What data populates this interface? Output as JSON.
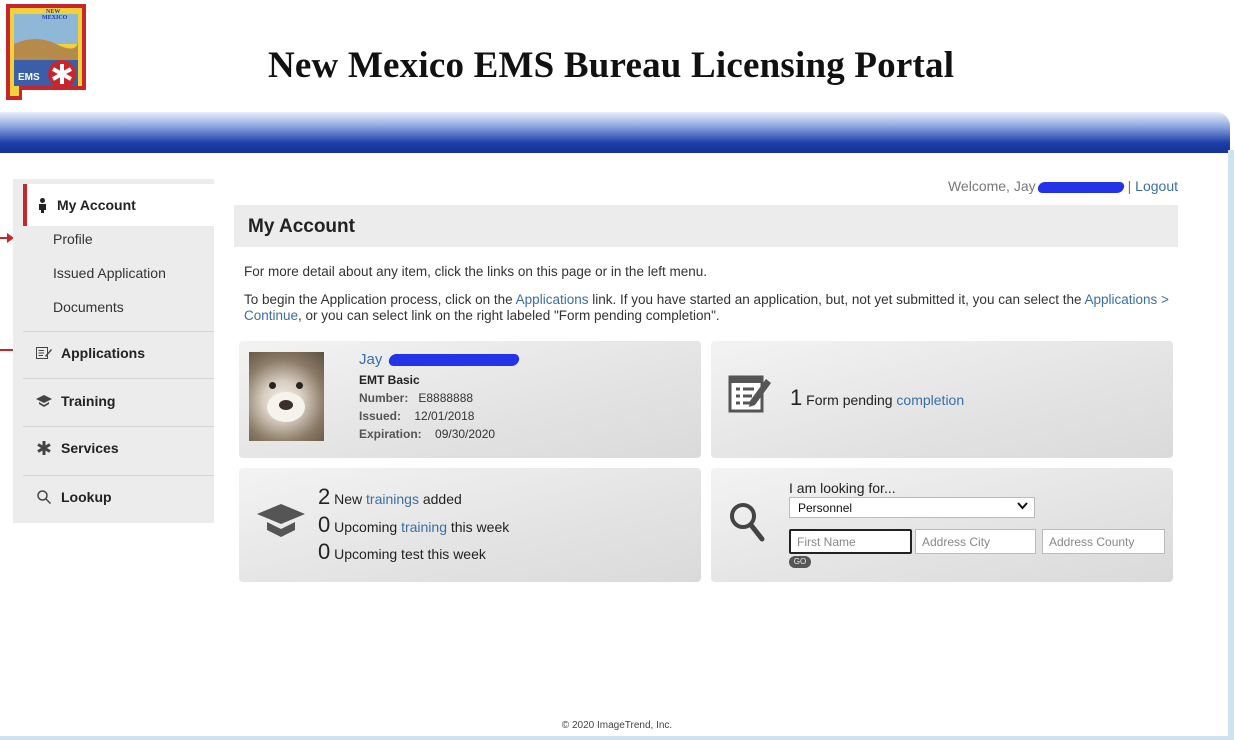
{
  "header": {
    "logo_alt": "NEW MEXICO EMS",
    "logo_top_text": "NEW MEXICO",
    "logo_bottom_text": "EMS",
    "title": "New Mexico EMS Bureau Licensing Portal"
  },
  "sidebar": {
    "my_account": {
      "label": "My Account",
      "icon": "person-icon"
    },
    "sub_items": [
      "Profile",
      "Issued Application",
      "Documents"
    ],
    "items": [
      {
        "label": "Applications",
        "icon": "form-edit-icon"
      },
      {
        "label": "Training",
        "icon": "graduation-cap-icon"
      },
      {
        "label": "Services",
        "icon": "star-of-life-icon"
      },
      {
        "label": "Lookup",
        "icon": "magnifier-icon"
      }
    ]
  },
  "welcome": {
    "text": "Welcome, Jay",
    "separator": "|",
    "logout": "Logout"
  },
  "main": {
    "heading": "My Account",
    "intro_line1": "For more detail about any item, click the links on this page or in the left menu.",
    "intro_line2_pre": "To begin the Application process, click on the ",
    "intro_line2_link1": "Applications",
    "intro_line2_mid": " link. If you have started an application, but, not yet submitted it, you can select the ",
    "intro_line2_link2": "Applications > Continue",
    "intro_line2_post": ", or you can select link on the right labeled \"Form pending completion\"."
  },
  "profile_card": {
    "name": "Jay",
    "level": "EMT Basic",
    "number_label": "Number:",
    "number_value": "E8888888",
    "issued_label": "Issued:",
    "issued_value": "12/01/2018",
    "expiration_label": "Expiration:",
    "expiration_value": "09/30/2020"
  },
  "forms_card": {
    "count": "1",
    "text": "Form pending ",
    "link": "completion"
  },
  "training_card": {
    "new_count": "2",
    "new_pre": "New ",
    "new_link": "trainings",
    "new_post": " added",
    "upcoming_count": "0",
    "upcoming_pre": "Upcoming ",
    "upcoming_link": "training",
    "upcoming_post": " this week",
    "test_count": "0",
    "test_text": "Upcoming test this week"
  },
  "search_card": {
    "label": "I am looking for...",
    "selected": "Personnel",
    "first_name_placeholder": "First Name",
    "city_placeholder": "Address City",
    "county_placeholder": "Address County",
    "go_label": "GO"
  },
  "footer": {
    "text": "© 2020 ImageTrend, Inc."
  },
  "colors": {
    "accent_red": "#c7262c",
    "link_blue": "#3a6ea5",
    "bar_blue": "#1f3ea8"
  }
}
